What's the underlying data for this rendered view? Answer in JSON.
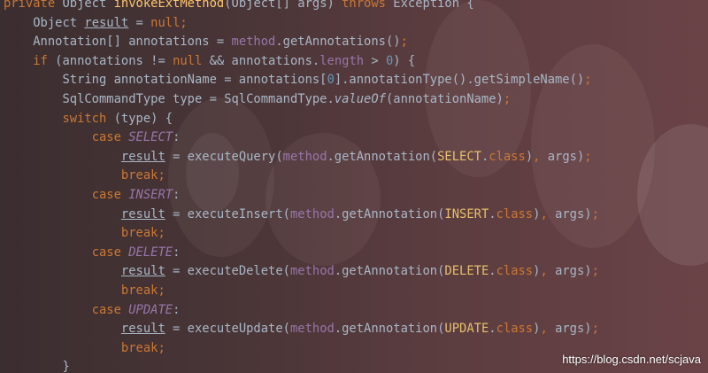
{
  "editor": {
    "lines": [
      {
        "indent": "",
        "tokens": [
          {
            "t": "private ",
            "c": "kw"
          },
          {
            "t": "Object "
          },
          {
            "t": "invokeExtMethod",
            "c": "fn"
          },
          {
            "t": "(Object[] args) "
          },
          {
            "t": "throws ",
            "c": "kw"
          },
          {
            "t": "Exception {"
          }
        ]
      },
      {
        "indent": "    ",
        "tokens": [
          {
            "t": "Object "
          },
          {
            "t": "result",
            "c": "u"
          },
          {
            "t": " = "
          },
          {
            "t": "null",
            "c": "kw"
          },
          {
            "t": ";",
            "c": "kw"
          }
        ]
      },
      {
        "indent": "    ",
        "tokens": [
          {
            "t": "Annotation[] annotations = "
          },
          {
            "t": "method",
            "c": "fld"
          },
          {
            "t": ".getAnnotations()"
          },
          {
            "t": ";",
            "c": "kw"
          }
        ]
      },
      {
        "indent": "    ",
        "tokens": [
          {
            "t": "if ",
            "c": "kw"
          },
          {
            "t": "(annotations != "
          },
          {
            "t": "null ",
            "c": "kw"
          },
          {
            "t": "&& annotations."
          },
          {
            "t": "length",
            "c": "fld"
          },
          {
            "t": " > "
          },
          {
            "t": "0",
            "c": "num"
          },
          {
            "t": ") {"
          }
        ]
      },
      {
        "indent": "        ",
        "tokens": [
          {
            "t": "String annotationName = annotations["
          },
          {
            "t": "0",
            "c": "num"
          },
          {
            "t": "].annotationType().getSimpleName()"
          },
          {
            "t": ";",
            "c": "kw"
          }
        ]
      },
      {
        "indent": "        ",
        "tokens": [
          {
            "t": "SqlCommandType type = SqlCommandType."
          },
          {
            "t": "valueOf",
            "c": "st"
          },
          {
            "t": "(annotationName)"
          },
          {
            "t": ";",
            "c": "kw"
          }
        ]
      },
      {
        "indent": "        ",
        "tokens": [
          {
            "t": "switch ",
            "c": "kw"
          },
          {
            "t": "(type) {"
          }
        ]
      },
      {
        "indent": "            ",
        "tokens": [
          {
            "t": "case ",
            "c": "kw"
          },
          {
            "t": "SELECT",
            "c": "en"
          },
          {
            "t": ":"
          }
        ]
      },
      {
        "indent": "                ",
        "tokens": [
          {
            "t": "result",
            "c": "u"
          },
          {
            "t": " = executeQuery("
          },
          {
            "t": "method",
            "c": "fld"
          },
          {
            "t": ".getAnnotation("
          },
          {
            "t": "SELECT",
            "c": "cls"
          },
          {
            "t": "."
          },
          {
            "t": "class",
            "c": "kw"
          },
          {
            "t": ")"
          },
          {
            "t": ", ",
            "c": "kw"
          },
          {
            "t": "args)"
          },
          {
            "t": ";",
            "c": "kw"
          }
        ]
      },
      {
        "indent": "                ",
        "tokens": [
          {
            "t": "break;",
            "c": "kw"
          }
        ]
      },
      {
        "indent": "            ",
        "tokens": [
          {
            "t": "case ",
            "c": "kw"
          },
          {
            "t": "INSERT",
            "c": "en"
          },
          {
            "t": ":"
          }
        ]
      },
      {
        "indent": "                ",
        "tokens": [
          {
            "t": "result",
            "c": "u"
          },
          {
            "t": " = executeInsert("
          },
          {
            "t": "method",
            "c": "fld"
          },
          {
            "t": ".getAnnotation("
          },
          {
            "t": "INSERT",
            "c": "cls"
          },
          {
            "t": "."
          },
          {
            "t": "class",
            "c": "kw"
          },
          {
            "t": ")"
          },
          {
            "t": ", ",
            "c": "kw"
          },
          {
            "t": "args)"
          },
          {
            "t": ";",
            "c": "kw"
          }
        ]
      },
      {
        "indent": "                ",
        "tokens": [
          {
            "t": "break;",
            "c": "kw"
          }
        ]
      },
      {
        "indent": "            ",
        "tokens": [
          {
            "t": "case ",
            "c": "kw"
          },
          {
            "t": "DELETE",
            "c": "en"
          },
          {
            "t": ":"
          }
        ]
      },
      {
        "indent": "                ",
        "tokens": [
          {
            "t": "result",
            "c": "u"
          },
          {
            "t": " = executeDelete("
          },
          {
            "t": "method",
            "c": "fld"
          },
          {
            "t": ".getAnnotation("
          },
          {
            "t": "DELETE",
            "c": "cls"
          },
          {
            "t": "."
          },
          {
            "t": "class",
            "c": "kw"
          },
          {
            "t": ")"
          },
          {
            "t": ", ",
            "c": "kw"
          },
          {
            "t": "args)"
          },
          {
            "t": ";",
            "c": "kw"
          }
        ]
      },
      {
        "indent": "                ",
        "tokens": [
          {
            "t": "break;",
            "c": "kw"
          }
        ]
      },
      {
        "indent": "            ",
        "tokens": [
          {
            "t": "case ",
            "c": "kw"
          },
          {
            "t": "UPDATE",
            "c": "en"
          },
          {
            "t": ":"
          }
        ]
      },
      {
        "indent": "                ",
        "tokens": [
          {
            "t": "result",
            "c": "u"
          },
          {
            "t": " = executeUpdate("
          },
          {
            "t": "method",
            "c": "fld"
          },
          {
            "t": ".getAnnotation("
          },
          {
            "t": "UPDATE",
            "c": "cls"
          },
          {
            "t": "."
          },
          {
            "t": "class",
            "c": "kw"
          },
          {
            "t": ")"
          },
          {
            "t": ", ",
            "c": "kw"
          },
          {
            "t": "args)"
          },
          {
            "t": ";",
            "c": "kw"
          }
        ]
      },
      {
        "indent": "                ",
        "tokens": [
          {
            "t": "break;",
            "c": "kw"
          }
        ]
      },
      {
        "indent": "        ",
        "tokens": [
          {
            "t": "}"
          }
        ]
      }
    ]
  },
  "watermark": "https://blog.csdn.net/scjava",
  "colors": {
    "keyword": "#cc7832",
    "method_decl": "#ffc66d",
    "field": "#9876aa",
    "number": "#6897bb",
    "annotation_class": "#e8bf6a",
    "default_text": "#a9b7c6"
  }
}
